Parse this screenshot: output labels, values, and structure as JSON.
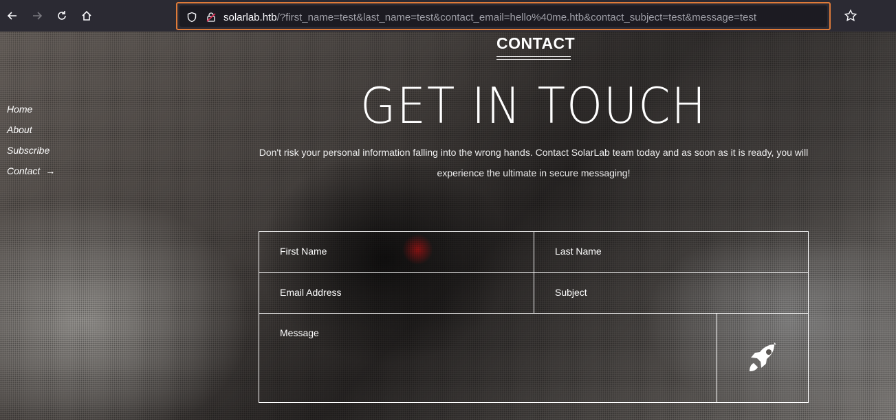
{
  "browser": {
    "url_host": "solarlab.htb",
    "url_rest": "/?first_name=test&last_name=test&contact_email=hello%40me.htb&contact_subject=test&message=test",
    "highlight_color": "#e07b39"
  },
  "nav": {
    "items": [
      "Home",
      "About",
      "Subscribe",
      "Contact"
    ],
    "active_arrow": "→"
  },
  "section_title": "CONTACT",
  "hero_title": "GET IN TOUCH",
  "lead_line1": "Don't risk your personal information falling into the wrong hands. Contact SolarLab team today and as soon as it is ready, you will",
  "lead_line2": "experience the ultimate in secure messaging!",
  "form": {
    "first_name_placeholder": "First Name",
    "last_name_placeholder": "Last Name",
    "email_placeholder": "Email Address",
    "subject_placeholder": "Subject",
    "message_placeholder": "Message",
    "submit_icon": "rocket-icon"
  }
}
